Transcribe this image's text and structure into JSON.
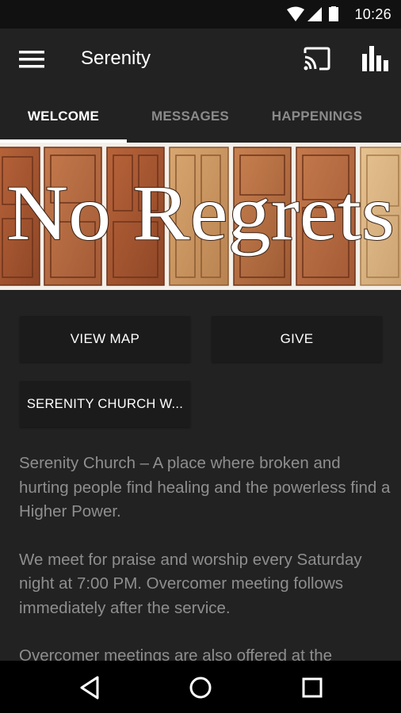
{
  "status_bar": {
    "time": "10:26",
    "icons": [
      "wifi-icon",
      "signal-icon",
      "battery-icon"
    ]
  },
  "app_bar": {
    "title": "Serenity",
    "icons": [
      "menu-icon",
      "cast-icon",
      "stats-icon"
    ]
  },
  "tabs": [
    {
      "label": "WELCOME",
      "active": true
    },
    {
      "label": "MESSAGES",
      "active": false
    },
    {
      "label": "HAPPENINGS",
      "active": false
    }
  ],
  "banner": {
    "text": "No Regrets"
  },
  "buttons": {
    "view_map": "VIEW MAP",
    "give": "GIVE",
    "website": "SERENITY CHURCH W..."
  },
  "content": {
    "paragraphs": [
      "Serenity Church – A place where broken and hurting people find healing and the powerless find a Higher Power.",
      "We meet for praise and worship every Saturday night at 7:00 PM. Overcomer meeting follows immediately after the service.",
      "Overcomer meetings are also offered at the"
    ]
  },
  "nav_bar": {
    "icons": [
      "back-icon",
      "home-icon",
      "recents-icon"
    ]
  },
  "colors": {
    "background": "#222222",
    "status_bar": "#111111",
    "nav_bar": "#000000",
    "button": "#1b1b1b",
    "text": "#8e8e8e"
  }
}
